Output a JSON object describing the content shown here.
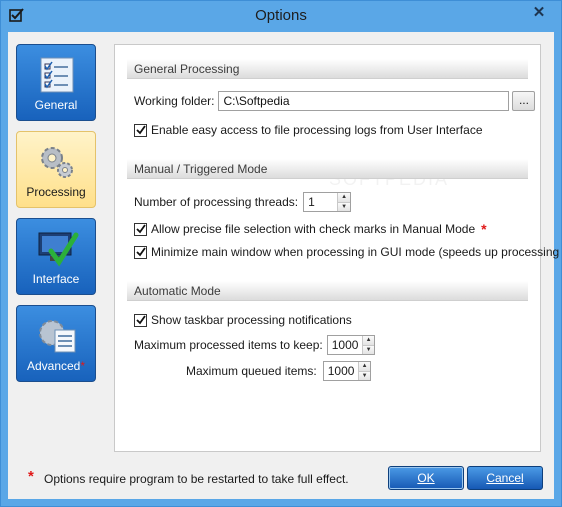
{
  "window": {
    "title": "Options",
    "close_glyph": "✕"
  },
  "nav": [
    {
      "label": "General",
      "icon": "checklist-icon",
      "active": false
    },
    {
      "label": "Processing",
      "icon": "gears-icon",
      "active": true
    },
    {
      "label": "Interface",
      "icon": "monitor-check-icon",
      "active": false
    },
    {
      "label": "Advanced",
      "icon": "gear-list-icon",
      "active": false,
      "restart_marker": "*"
    }
  ],
  "general_processing": {
    "header": "General Processing",
    "working_folder_label": "Working folder:",
    "working_folder_value": "C:\\Softpedia",
    "browse_label": "...",
    "easy_access_label": "Enable easy access to file processing logs from User Interface",
    "easy_access_checked": true
  },
  "manual_mode": {
    "header": "Manual / Triggered Mode",
    "threads_label": "Number of processing threads:",
    "threads_value": "1",
    "precise_label": "Allow precise file selection with check marks in Manual Mode",
    "precise_checked": true,
    "precise_marker": "*",
    "minimize_label": "Minimize main window when processing in GUI mode (speeds up processing a bit)",
    "minimize_checked": true
  },
  "automatic_mode": {
    "header": "Automatic Mode",
    "taskbar_label": "Show taskbar processing notifications",
    "taskbar_checked": true,
    "max_processed_label": "Maximum processed items to keep:",
    "max_processed_value": "1000",
    "max_queued_label": "Maximum queued items:",
    "max_queued_value": "1000"
  },
  "footer": {
    "marker": "*",
    "note": "Options require program to be restarted to take full effect.",
    "ok_label": "OK",
    "cancel_label": "Cancel"
  },
  "colors": {
    "frame": "#5aa7e7",
    "nav_active": "#ffe08a",
    "nav_inactive": "#1862bc",
    "required_marker": "#e01818"
  }
}
